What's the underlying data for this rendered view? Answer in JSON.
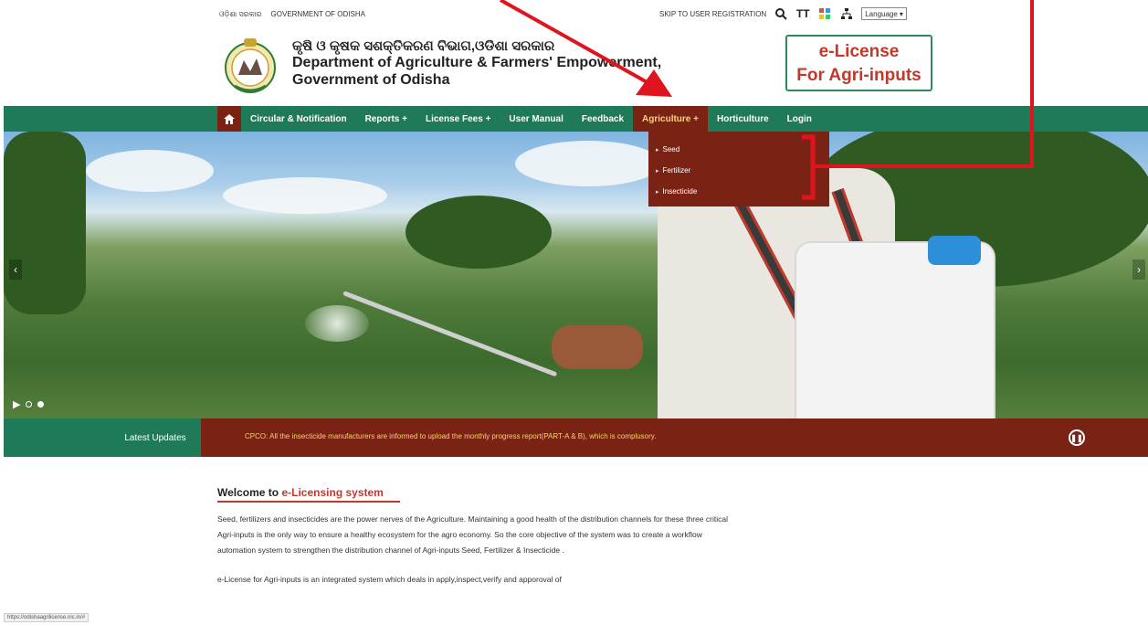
{
  "topbar": {
    "odia_link": "ଓଡ଼ିଶା ସରକାର",
    "gov_link": "GOVERNMENT OF ODISHA",
    "skip_link": "SKIP TO USER REGISTRATION",
    "text_size_label": "TT",
    "language_label": "Language"
  },
  "header": {
    "dept_odia": "କୃଷି ଓ କୃଷକ ସଶକ୍ତିକରଣ ବିଭାଗ,ଓଡିଶା ସରକାର",
    "dept_en_line1": "Department of Agriculture & Farmers' Empowerment,",
    "dept_en_line2": "Government of Odisha",
    "elicense_line1": "e-License",
    "elicense_line2": "For Agri-inputs"
  },
  "nav": {
    "items": [
      {
        "label": "Circular & Notification"
      },
      {
        "label": "Reports +"
      },
      {
        "label": "License Fees +"
      },
      {
        "label": "User Manual"
      },
      {
        "label": "Feedback"
      },
      {
        "label": "Agriculture +"
      },
      {
        "label": "Horticulture"
      },
      {
        "label": "Login"
      }
    ]
  },
  "dropdown": {
    "items": [
      {
        "label": "Seed"
      },
      {
        "label": "Fertilizer"
      },
      {
        "label": "Insecticide"
      }
    ]
  },
  "updates": {
    "label": "Latest Updates",
    "text": "CPCO: All the insecticide manufacturers are informed to upload the monthly progress report(PART-A & B), which is complusory."
  },
  "welcome": {
    "title_prefix": "Welcome to",
    "title_accent": "e-Licensing system",
    "para1": "Seed, fertilizers and insecticides are the power nerves of the Agriculture. Maintaining a good health of the distribution channels for these three critical Agri-inputs is the only way to ensure a healthy ecosystem for the agro economy. So the core objective of the system was to create a workflow automation system to strengthen the distribution channel of Agri-inputs Seed, Fertilizer & Insecticide .",
    "para2": "e-License for Agri-inputs is an integrated system which deals in apply,inspect,verify and apporoval of"
  },
  "status_url": "https://odishaagrilicense.nic.in/#",
  "colors": {
    "nav_green": "#1f7a57",
    "maroon": "#7a2315",
    "accent_red": "#c0392b",
    "annotation_red": "#e0141e"
  },
  "icons": [
    "home-icon",
    "search-icon",
    "text-size-icon",
    "color-contrast-icon",
    "sitemap-icon",
    "play-icon",
    "pause-icon",
    "chevron-left-icon",
    "chevron-right-icon"
  ]
}
